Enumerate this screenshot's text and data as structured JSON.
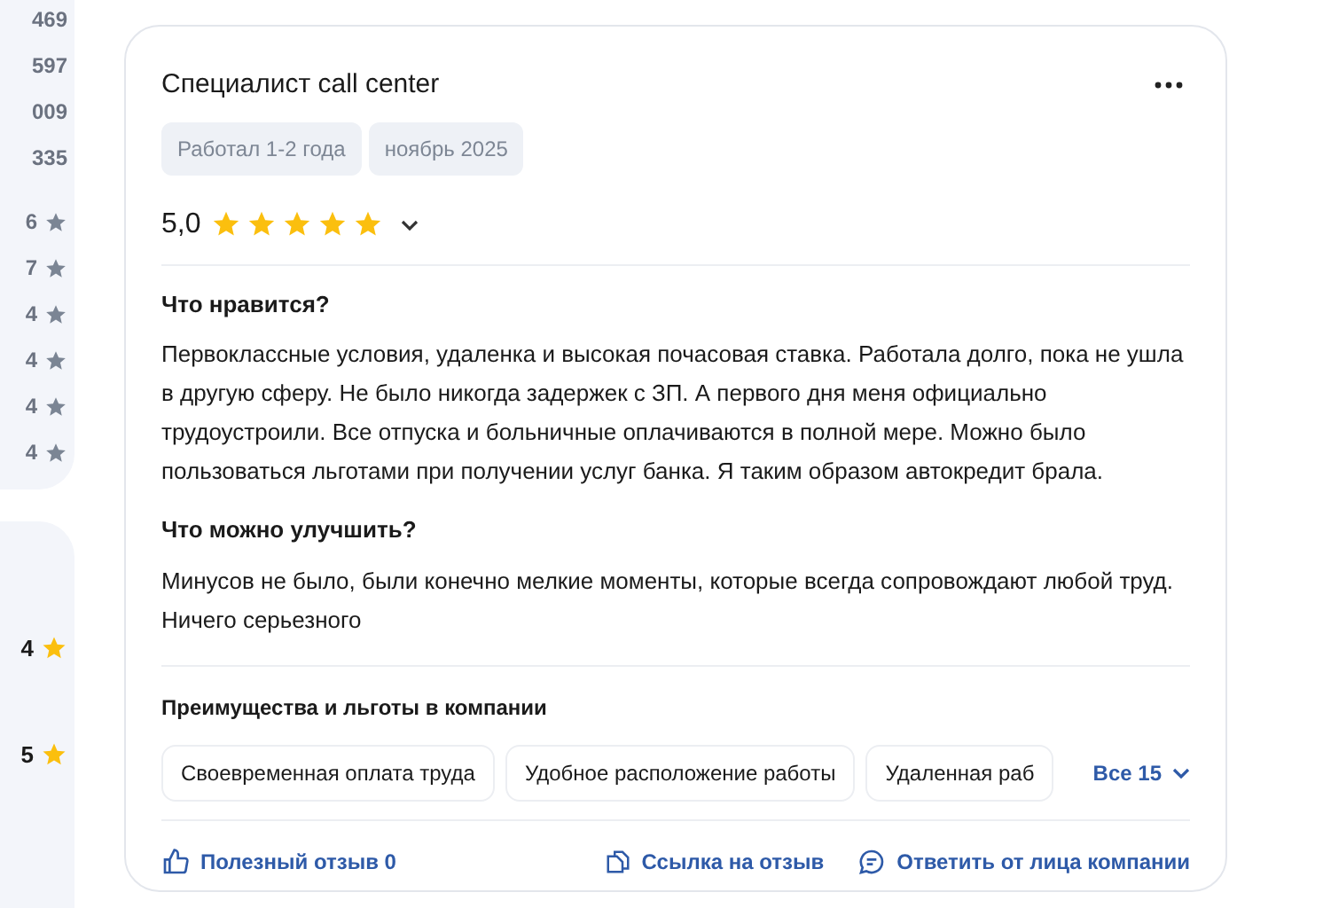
{
  "sidebar": {
    "counts": [
      "469",
      "597",
      "009",
      "335"
    ],
    "ratings": [
      {
        "value": "6",
        "color": "#7b8594"
      },
      {
        "value": "7",
        "color": "#7b8594"
      },
      {
        "value": "4",
        "color": "#7b8594"
      },
      {
        "value": "4",
        "color": "#7b8594"
      },
      {
        "value": "4",
        "color": "#7b8594"
      },
      {
        "value": "4",
        "color": "#7b8594"
      }
    ],
    "scores": [
      {
        "value": "4",
        "color": "#fbbf0e"
      },
      {
        "value": "5",
        "color": "#fbbf0e"
      }
    ]
  },
  "review": {
    "title": "Специалист call center",
    "tags": [
      "Работал 1-2 года",
      "ноябрь 2025"
    ],
    "rating": "5,0",
    "stars": 5,
    "sections": [
      {
        "heading": "Что нравится?",
        "text": "Первоклассные условия, удаленка и высокая почасовая ставка. Работала долго, пока не ушла в другую сферу. Не было никогда задержек с ЗП. А первого дня меня официально трудоустроили. Все отпуска и больничные оплачиваются в полной мере. Можно было пользоваться льготами при получении услуг банка. Я таким образом автокредит брала."
      },
      {
        "heading": "Что можно улучшить?",
        "text": "Минусов не было, были конечно мелкие моменты, которые всегда сопровождают любой труд. Ничего серьезного"
      }
    ],
    "benefits": {
      "heading": "Преимущества и льготы в компании",
      "items": [
        "Своевременная оплата труда",
        "Удобное расположение работы",
        "Удаленная раб"
      ],
      "more": "Все 15"
    },
    "actions": [
      {
        "kind": "like",
        "label": "Полезный отзыв 0"
      },
      {
        "kind": "link",
        "label": "Ссылка на отзыв"
      },
      {
        "kind": "reply",
        "label": "Ответить от лица компании"
      }
    ]
  }
}
